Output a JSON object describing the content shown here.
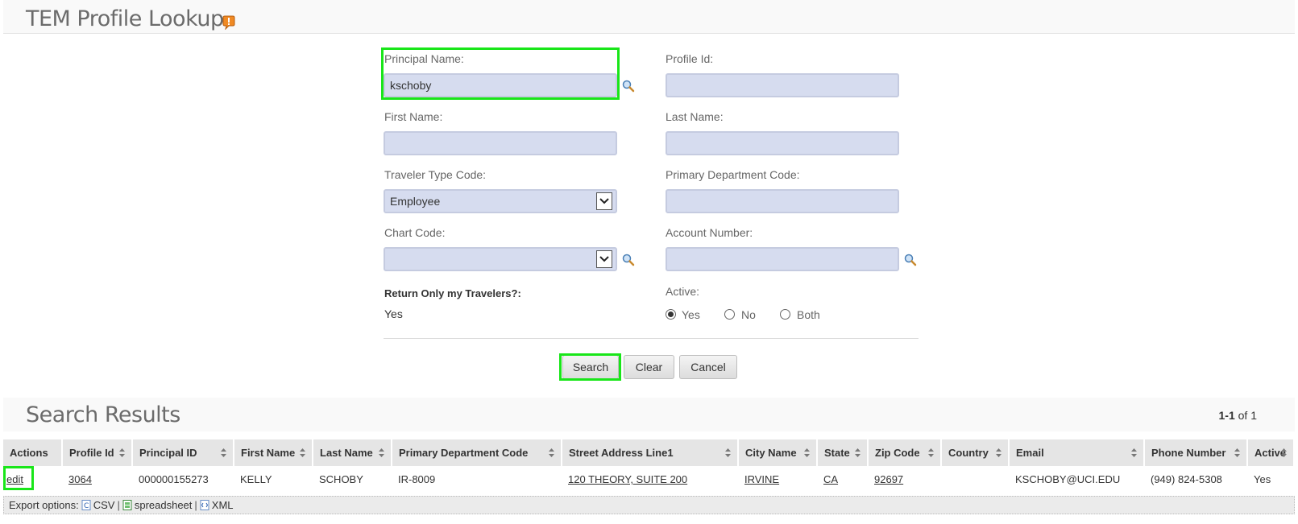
{
  "header": {
    "title": "TEM Profile Lookup"
  },
  "form": {
    "principal_name": {
      "label": "Principal Name:",
      "value": "kschoby"
    },
    "profile_id": {
      "label": "Profile Id:",
      "value": ""
    },
    "first_name": {
      "label": "First Name:",
      "value": ""
    },
    "last_name": {
      "label": "Last Name:",
      "value": ""
    },
    "traveler_type_code": {
      "label": "Traveler Type Code:",
      "value": "Employee"
    },
    "primary_department_code": {
      "label": "Primary Department Code:",
      "value": ""
    },
    "chart_code": {
      "label": "Chart Code:",
      "value": ""
    },
    "account_number": {
      "label": "Account Number:",
      "value": ""
    },
    "return_only_my_travelers": {
      "label": "Return Only my Travelers?:",
      "value": "Yes"
    },
    "active": {
      "label": "Active:",
      "options": [
        "Yes",
        "No",
        "Both"
      ],
      "selected": "Yes"
    }
  },
  "buttons": {
    "search": "Search",
    "clear": "Clear",
    "cancel": "Cancel"
  },
  "results": {
    "title": "Search Results",
    "pager_range": "1-1",
    "pager_of": "of 1",
    "columns": [
      "Actions",
      "Profile Id",
      "Principal ID",
      "First Name",
      "Last Name",
      "Primary Department Code",
      "Street Address Line1",
      "City Name",
      "State",
      "Zip Code",
      "Country",
      "Email",
      "Phone Number",
      "Active"
    ],
    "rows": [
      {
        "action": "edit",
        "profile_id": "3064",
        "principal_id": "000000155273",
        "first_name": "KELLY",
        "last_name": "SCHOBY",
        "department": "IR-8009",
        "street": "120 THEORY, SUITE 200",
        "city": "IRVINE",
        "state": "CA",
        "zip": "92697",
        "country": "",
        "email": "KSCHOBY@UCI.EDU",
        "phone": "(949) 824-5308",
        "active": "Yes"
      }
    ]
  },
  "export": {
    "label": "Export options:",
    "csv": "CSV",
    "spreadsheet": "spreadsheet",
    "xml": "XML",
    "separator": "|"
  },
  "icons": {
    "help": "help-bubble-icon",
    "lookup": "magnifier-icon",
    "sort": "sort-arrows-icon"
  },
  "colors": {
    "highlight": "#19e619",
    "input_bg": "#d6dcef",
    "header_bg": "#e5e5e5"
  }
}
